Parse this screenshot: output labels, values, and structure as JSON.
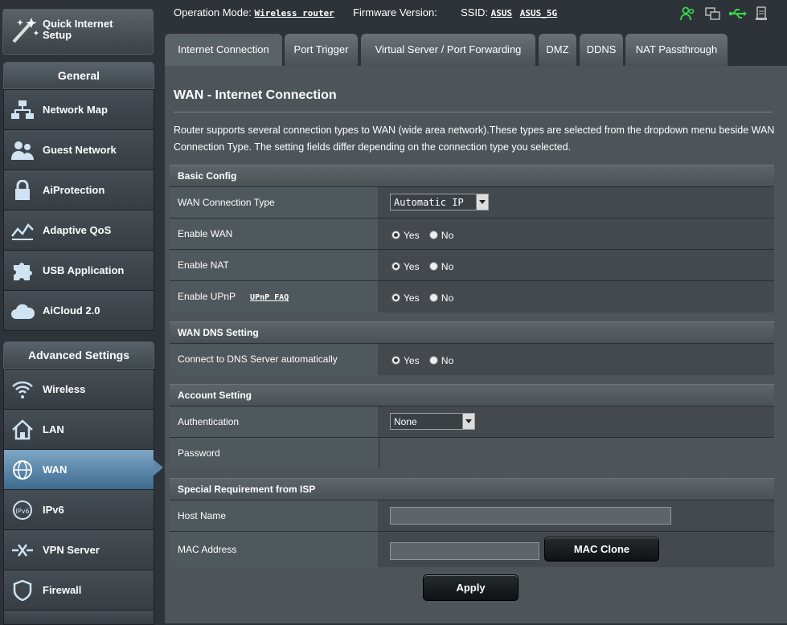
{
  "topbar": {
    "op_mode_label": "Operation Mode:",
    "op_mode_value": "Wireless router",
    "firmware_label": "Firmware Version:",
    "ssid_label": "SSID:",
    "ssid_1": "ASUS",
    "ssid_2": "ASUS_5G"
  },
  "sidebar": {
    "quick_setup": "Quick Internet Setup",
    "general_title": "General",
    "general_items": [
      {
        "label": "Network Map",
        "icon": "network-map-icon"
      },
      {
        "label": "Guest Network",
        "icon": "guest-network-icon"
      },
      {
        "label": "AiProtection",
        "icon": "lock-icon"
      },
      {
        "label": "Adaptive QoS",
        "icon": "qos-icon"
      },
      {
        "label": "USB Application",
        "icon": "puzzle-icon"
      },
      {
        "label": "AiCloud 2.0",
        "icon": "cloud-icon"
      }
    ],
    "advanced_title": "Advanced Settings",
    "advanced_items": [
      {
        "label": "Wireless",
        "icon": "wifi-icon"
      },
      {
        "label": "LAN",
        "icon": "home-icon"
      },
      {
        "label": "WAN",
        "icon": "globe-icon",
        "active": true
      },
      {
        "label": "IPv6",
        "icon": "ipv6-icon"
      },
      {
        "label": "VPN Server",
        "icon": "vpn-icon"
      },
      {
        "label": "Firewall",
        "icon": "shield-icon"
      }
    ]
  },
  "tabs": [
    "Internet Connection",
    "Port Trigger",
    "Virtual Server / Port Forwarding",
    "DMZ",
    "DDNS",
    "NAT Passthrough"
  ],
  "page": {
    "title": "WAN - Internet Connection",
    "description": "Router supports several connection types to WAN (wide area network).These types are selected from the dropdown menu beside WAN Connection Type. The setting fields differ depending on the connection type you selected."
  },
  "basic_config": {
    "header": "Basic Config",
    "wan_type_label": "WAN Connection Type",
    "wan_type_value": "Automatic IP",
    "enable_wan_label": "Enable WAN",
    "enable_nat_label": "Enable NAT",
    "enable_upnp_label": "Enable UPnP",
    "upnp_faq": "UPnP FAQ"
  },
  "dns": {
    "header": "WAN DNS Setting",
    "auto_label": "Connect to DNS Server automatically"
  },
  "account": {
    "header": "Account Setting",
    "auth_label": "Authentication",
    "auth_value": "None",
    "password_label": "Password"
  },
  "isp": {
    "header": "Special Requirement from ISP",
    "host_label": "Host Name",
    "host_value": "",
    "mac_label": "MAC Address",
    "mac_value": "",
    "mac_clone": "MAC Clone"
  },
  "radio": {
    "yes": "Yes",
    "no": "No"
  },
  "apply": "Apply"
}
